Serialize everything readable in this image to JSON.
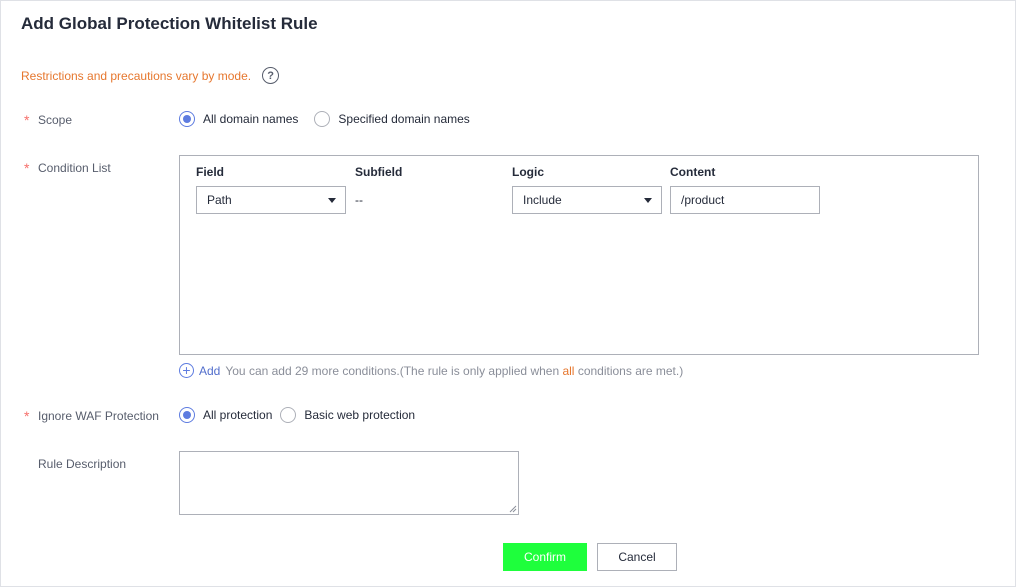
{
  "dialog": {
    "title": "Add Global Protection Whitelist Rule",
    "notice": "Restrictions and precautions vary by mode.",
    "help_icon": "question-circle-icon"
  },
  "scope": {
    "label": "Scope",
    "required": true,
    "options": [
      {
        "label": "All domain names",
        "checked": true
      },
      {
        "label": "Specified domain names",
        "checked": false
      }
    ]
  },
  "condition_list": {
    "label": "Condition List",
    "required": true,
    "columns": [
      "Field",
      "Subfield",
      "Logic",
      "Content"
    ],
    "rows": [
      {
        "field": "Path",
        "subfield": "--",
        "logic": "Include",
        "content": "/product"
      }
    ],
    "add_link": "Add",
    "add_hint_before": "You can add 29 more conditions.(The rule is only applied when ",
    "add_hint_highlight": "all",
    "add_hint_after": " conditions are met.)"
  },
  "ignore_waf": {
    "label": "Ignore WAF Protection",
    "required": true,
    "options": [
      {
        "label": "All protection",
        "checked": true
      },
      {
        "label": "Basic web protection",
        "checked": false
      }
    ]
  },
  "rule_description": {
    "label": "Rule Description",
    "value": ""
  },
  "actions": {
    "confirm": "Confirm",
    "cancel": "Cancel"
  },
  "colors": {
    "accent": "#5e7ce0",
    "required_star": "#f66f6a",
    "notice": "#e6772e",
    "confirm_bg": "#1eff3c"
  }
}
